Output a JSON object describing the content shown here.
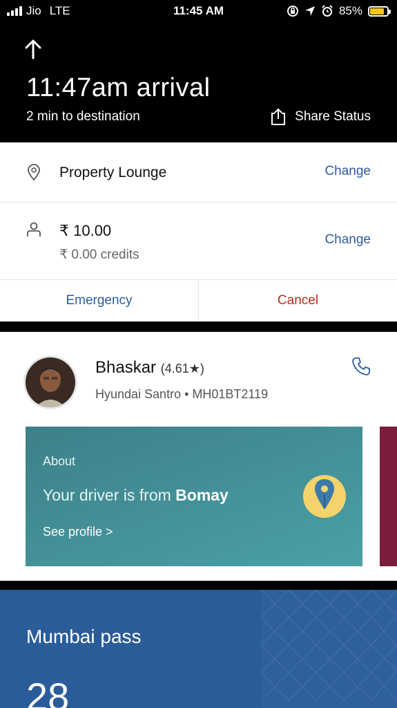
{
  "status_bar": {
    "carrier": "Jio",
    "network": "LTE",
    "time": "11:45 AM",
    "battery": "85%",
    "battery_level": 0.85,
    "battery_color": "#f5c518"
  },
  "header": {
    "arrival": "11:47am arrival",
    "eta": "2 min to destination",
    "share_label": "Share Status"
  },
  "destination": {
    "name": "Property Lounge",
    "change_label": "Change"
  },
  "payment": {
    "fare": "₹ 10.00",
    "credits": "₹ 0.00 credits",
    "change_label": "Change"
  },
  "actions": {
    "emergency": "Emergency",
    "cancel": "Cancel"
  },
  "driver": {
    "name": "Bhaskar",
    "rating": "(4.61★)",
    "vehicle": "Hyundai Santro • MH01BT2119"
  },
  "about_card": {
    "title": "About",
    "text": "Your driver is from",
    "city": "Bomay",
    "link": "See profile >"
  },
  "pass": {
    "title": "Mumbai pass",
    "number": "28"
  },
  "colors": {
    "link_blue": "#2d5b9e",
    "cancel_red": "#c0281c",
    "teal": "#4aa0a8",
    "pass_blue": "#2b5c9a"
  }
}
